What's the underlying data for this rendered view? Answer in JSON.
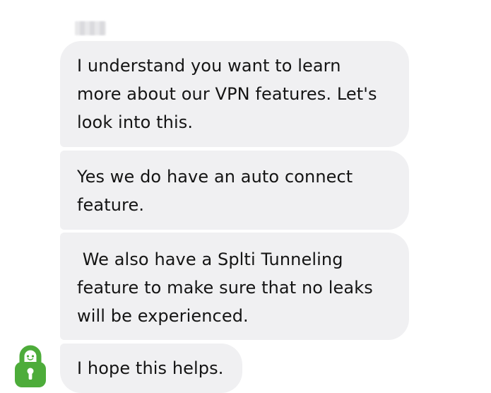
{
  "chat": {
    "messages": [
      {
        "text": "I understand you want to learn\nmore about our VPN features. Let's\nlook into this."
      },
      {
        "text": "Yes we do have an auto connect\nfeature."
      },
      {
        "text": " We also have a Splti Tunneling\nfeature to make sure that no leaks\nwill be experienced."
      },
      {
        "text": "I hope this helps."
      }
    ],
    "avatar_icon": "padlock-avatar-icon",
    "bubble_color": "#f0f0f2",
    "avatar_color": "#4dac3a"
  }
}
